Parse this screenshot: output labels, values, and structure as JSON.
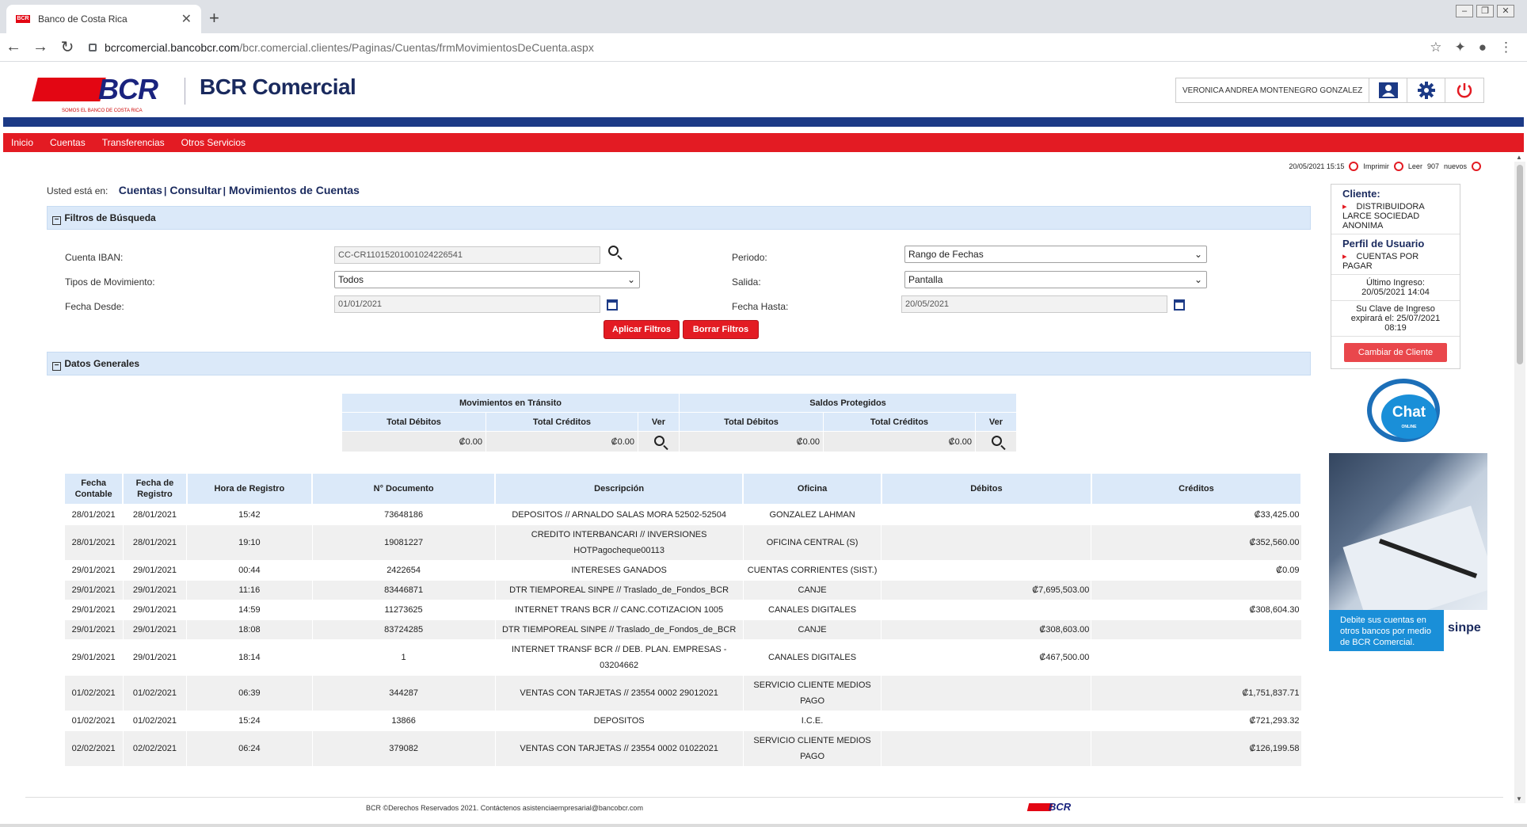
{
  "browser": {
    "tab_title": "Banco de Costa Rica",
    "tab_close": "✕",
    "new_tab": "+",
    "favicon_text": "BCR",
    "url_host": "bcrcomercial.bancobcr.com",
    "url_path": "/bcr.comercial.clientes/Paginas/Cuentas/frmMovimientosDeCuenta.aspx",
    "back": "←",
    "forward": "→",
    "reload": "↻",
    "star": "☆",
    "extensions": "✦",
    "profile": "●",
    "menu": "⋮",
    "win_min": "–",
    "win_max": "❐",
    "win_close": "✕"
  },
  "header": {
    "logo_text": "BCR",
    "logo_tagline": "SOMOS EL BANCO DE COSTA RICA",
    "brand": "BCR Comercial",
    "user_name": "VERONICA ANDREA MONTENEGRO GONZALEZ",
    "icons": [
      "user-icon",
      "gear-icon",
      "power-icon"
    ]
  },
  "menu": {
    "items": [
      "Inicio",
      "Cuentas",
      "Transferencias",
      "Otros Servicios"
    ]
  },
  "status": {
    "datetime": "20/05/2021 15:15",
    "print_label": "Imprimir",
    "read_label": "Leer",
    "count": "907",
    "new_label": "nuevos"
  },
  "breadcrumb": {
    "prefix": "Usted está en:",
    "part1": "Cuentas",
    "part2": "Consultar",
    "part3": "Movimientos de Cuentas",
    "sep": "|"
  },
  "filters": {
    "toggle": "−",
    "title": "Filtros de Búsqueda",
    "iban_label": "Cuenta IBAN:",
    "iban_value": "CC-CR11015201001024226541",
    "period_label": "Periodo:",
    "period_value": "Rango de Fechas",
    "mov_type_label": "Tipos de Movimiento:",
    "mov_type_value": "Todos",
    "output_label": "Salida:",
    "output_value": "Pantalla",
    "from_label": "Fecha Desde:",
    "from_value": "01/01/2021",
    "to_label": "Fecha Hasta:",
    "to_value": "20/05/2021",
    "apply_label": "Aplicar Filtros",
    "clear_label": "Borrar Filtros"
  },
  "general": {
    "toggle": "−",
    "title": "Datos Generales",
    "transit_header": "Movimientos en Tránsito",
    "protected_header": "Saldos Protegidos",
    "total_debits": "Total Débitos",
    "total_credits": "Total Créditos",
    "see": "Ver",
    "transit_debits": "₡0.00",
    "transit_credits": "₡0.00",
    "protected_debits": "₡0.00",
    "protected_credits": "₡0.00"
  },
  "movements": {
    "columns": [
      "Fecha Contable",
      "Fecha de Registro",
      "Hora de Registro",
      "N° Documento",
      "Descripción",
      "Oficina",
      "Débitos",
      "Créditos"
    ],
    "rows": [
      [
        "28/01/2021",
        "28/01/2021",
        "15:42",
        "73648186",
        "DEPOSITOS // ARNALDO SALAS MORA 52502-52504",
        "GONZALEZ LAHMAN",
        "",
        "₡33,425.00"
      ],
      [
        "28/01/2021",
        "28/01/2021",
        "19:10",
        "19081227",
        "CREDITO INTERBANCARI // INVERSIONES HOTPagocheque00113",
        "OFICINA CENTRAL (S)",
        "",
        "₡352,560.00"
      ],
      [
        "29/01/2021",
        "29/01/2021",
        "00:44",
        "2422654",
        "INTERESES GANADOS",
        "CUENTAS CORRIENTES (SIST.)",
        "",
        "₡0.09"
      ],
      [
        "29/01/2021",
        "29/01/2021",
        "11:16",
        "83446871",
        "DTR TIEMPOREAL SINPE // Traslado_de_Fondos_BCR",
        "CANJE",
        "₡7,695,503.00",
        ""
      ],
      [
        "29/01/2021",
        "29/01/2021",
        "14:59",
        "11273625",
        "INTERNET TRANS BCR // CANC.COTIZACION 1005",
        "CANALES DIGITALES",
        "",
        "₡308,604.30"
      ],
      [
        "29/01/2021",
        "29/01/2021",
        "18:08",
        "83724285",
        "DTR TIEMPOREAL SINPE // Traslado_de_Fondos_de_BCR",
        "CANJE",
        "₡308,603.00",
        ""
      ],
      [
        "29/01/2021",
        "29/01/2021",
        "18:14",
        "1",
        "INTERNET TRANSF BCR // DEB. PLAN. EMPRESAS - 03204662",
        "CANALES DIGITALES",
        "₡467,500.00",
        ""
      ],
      [
        "01/02/2021",
        "01/02/2021",
        "06:39",
        "344287",
        "VENTAS CON TARJETAS // 23554 0002 29012021",
        "SERVICIO CLIENTE MEDIOS PAGO",
        "",
        "₡1,751,837.71"
      ],
      [
        "01/02/2021",
        "01/02/2021",
        "15:24",
        "13866",
        "DEPOSITOS",
        "I.C.E.",
        "",
        "₡721,293.32"
      ],
      [
        "02/02/2021",
        "02/02/2021",
        "06:24",
        "379082",
        "VENTAS CON TARJETAS // 23554 0002 01022021",
        "SERVICIO CLIENTE MEDIOS PAGO",
        "",
        "₡126,199.58"
      ]
    ]
  },
  "sidebar": {
    "client_header": "Cliente:",
    "client_name": "DISTRIBUIDORA LARCE SOCIEDAD ANONIMA",
    "profile_header": "Perfil de Usuario",
    "profile_value": "CUENTAS POR PAGAR",
    "last_login_label": "Último Ingreso:",
    "last_login_value": "20/05/2021 14:04",
    "password_note": "Su Clave de Ingreso expirará el: 25/07/2021 08:19",
    "change_client": "Cambiar de Cliente",
    "chat_label": "Chat",
    "chat_sub": "ONLINE",
    "ad_text": "Debite sus cuentas en otros bancos por medio de BCR Comercial.",
    "ad_brand": "sinpe"
  },
  "footer": {
    "text": "BCR ©Derechos Reservados 2021. Contáctenos asistenciaempresarial@bancobcr.com",
    "logo_text": "BCR"
  }
}
